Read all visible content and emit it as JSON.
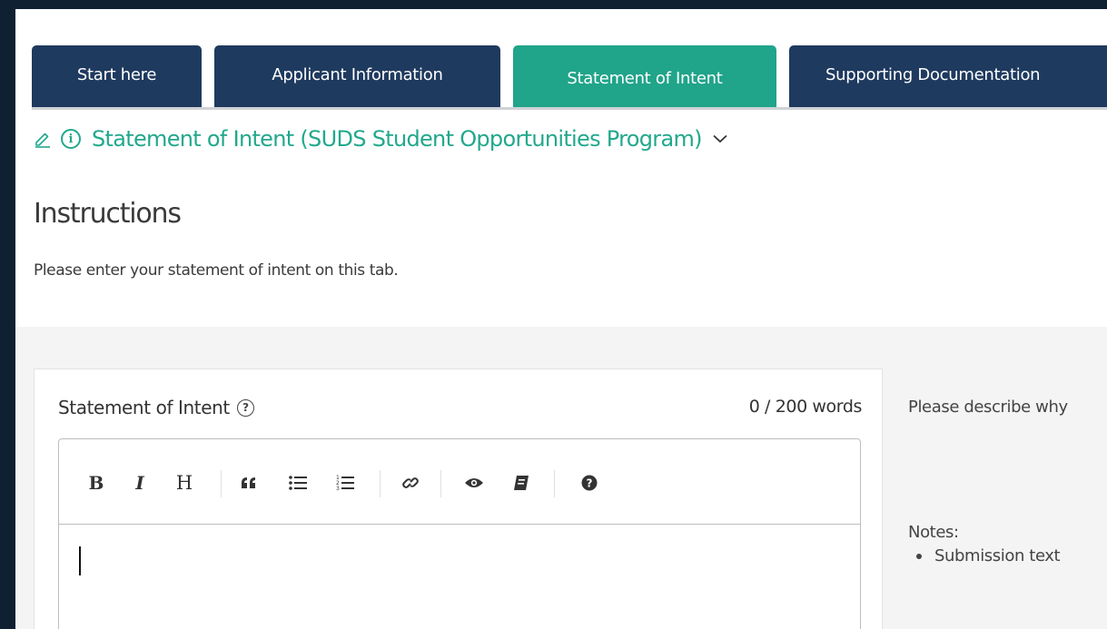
{
  "tabs": [
    {
      "label": "Start here",
      "active": false
    },
    {
      "label": "Applicant Information",
      "active": false
    },
    {
      "label": "Statement of Intent",
      "active": true
    },
    {
      "label": "Supporting Documentation",
      "active": false
    }
  ],
  "section": {
    "title": "Statement of Intent (SUDS Student Opportunities Program)",
    "icons": [
      "pencil-icon",
      "info-icon",
      "chevron-down-icon"
    ]
  },
  "instructions": {
    "heading": "Instructions",
    "text": "Please enter your statement of intent on this tab."
  },
  "field": {
    "label": "Statement of Intent",
    "help_icon": "?",
    "word_count": "0 / 200 words",
    "value": ""
  },
  "toolbar": {
    "bold": "B",
    "italic": "I",
    "heading": "H",
    "icons": [
      "quote-icon",
      "unordered-list-icon",
      "ordered-list-icon",
      "link-icon",
      "preview-icon",
      "guide-icon",
      "help-icon"
    ]
  },
  "side": {
    "description": "Please describe why",
    "notes_label": "Notes:",
    "notes": [
      "Submission text"
    ]
  },
  "colors": {
    "tab": "#1f3a5f",
    "tab_active": "#20a48a",
    "accent": "#22a88c",
    "background": "#0f2033"
  }
}
